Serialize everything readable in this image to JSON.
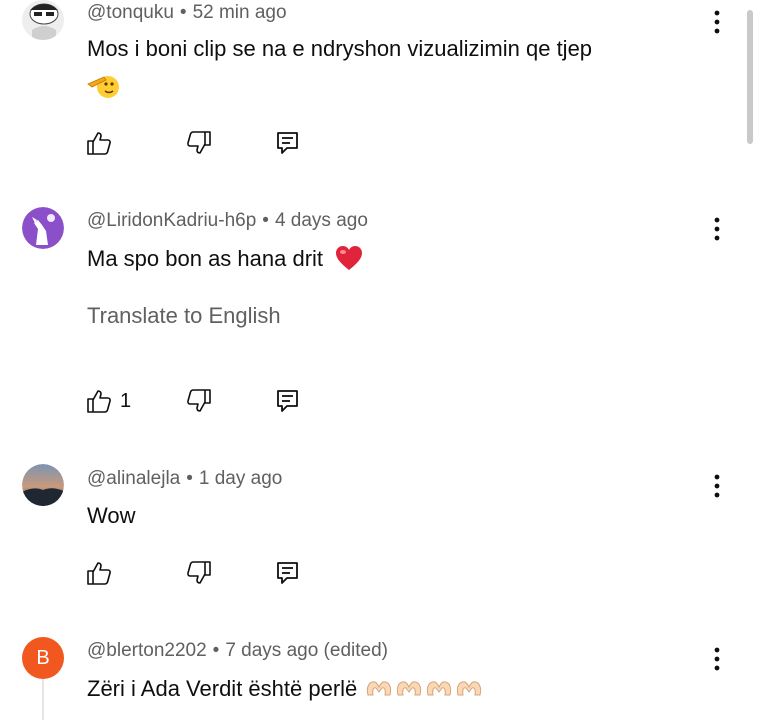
{
  "comments": [
    {
      "handle": "@tonquku",
      "time": "52 min ago",
      "text": "Mos i boni clip se na e ndryshon vizualizimin qe tjep",
      "likes": "",
      "translate": ""
    },
    {
      "handle": "@LiridonKadriu-h6p",
      "time": "4 days ago",
      "text": "Ma spo bon as hana drit",
      "likes": "1",
      "translate": "Translate to English"
    },
    {
      "handle": "@alinalejla",
      "time": "1 day ago",
      "text": "Wow",
      "likes": "",
      "translate": ""
    },
    {
      "handle": "@blerton2202",
      "time": "7 days ago (edited)",
      "text": "Zëri i Ada Verdit është perlë",
      "likes": "",
      "translate": "",
      "avatar_letter": "B"
    }
  ],
  "separator": "•",
  "colors": {
    "secondary_text": "#606060",
    "avatar_b": "#f0581f",
    "heart": "#e0243a"
  },
  "icons": [
    "like-icon",
    "dislike-icon",
    "reply-icon",
    "more-vert-icon"
  ]
}
